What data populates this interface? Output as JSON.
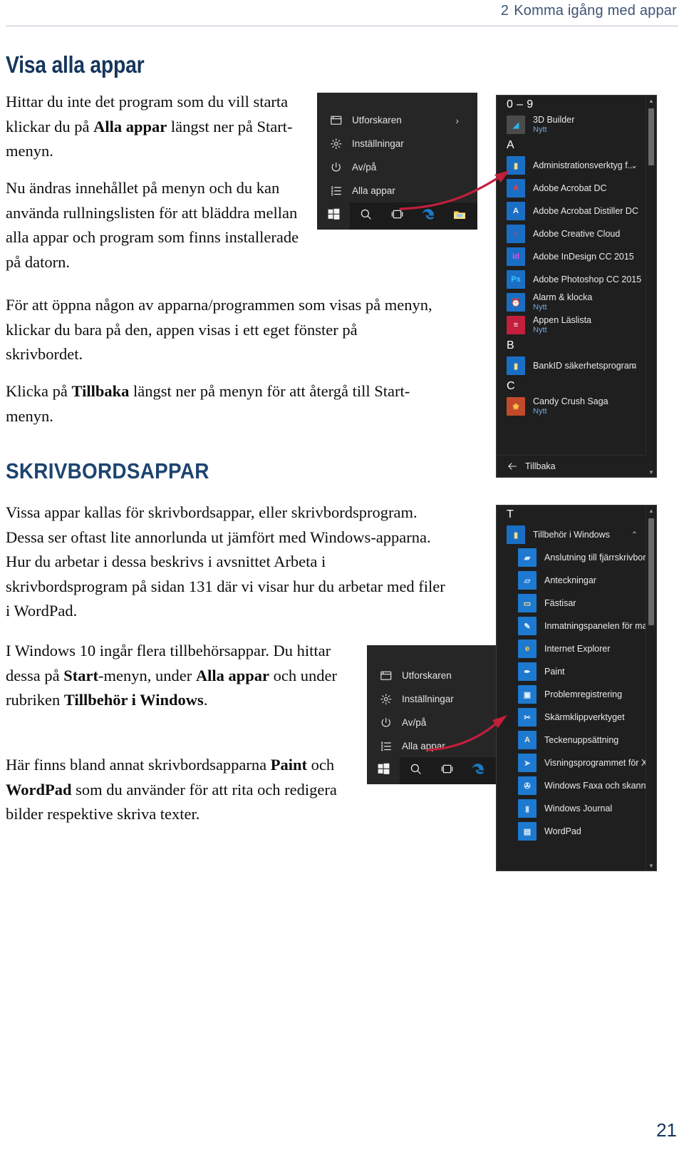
{
  "running_head": {
    "chapter_number": "2",
    "chapter_title": "Komma igång med appar"
  },
  "page_number": "21",
  "headings": {
    "h1": "Visa alla appar",
    "h2": "SKRIVBORDSAPPAR"
  },
  "paragraphs": {
    "p1_a": "Hittar du inte det program som du vill starta klickar du på ",
    "p1_b": "Alla appar",
    "p1_c": " längst ner på Start-menyn.",
    "p2": "Nu ändras innehållet på menyn och du kan använda rullningslisten för att bläddra mellan alla appar och program som finns installerade på datorn.",
    "p3": "För att öppna någon av apparna/programmen som visas på menyn, klickar du bara på den, appen visas i ett eget fönster på skrivbordet.",
    "p4_a": "Klicka på ",
    "p4_b": "Tillbaka",
    "p4_c": " längst ner på menyn för att återgå till Start-menyn.",
    "p5": "Vissa appar kallas för skrivbordsappar, eller skrivbordsprogram. Dessa ser oftast lite annorlunda ut jämfört med Windows-apparna. Hur du arbetar i dessa beskrivs i avsnittet Arbeta i skrivbordsprogram på sidan 131 där vi visar hur du arbetar med filer i WordPad.",
    "p6_a": "I Windows 10 ingår flera tillbehörsappar. Du hittar dessa på ",
    "p6_b": "Start",
    "p6_c": "-menyn, under ",
    "p6_d": "Alla appar",
    "p6_e": " och under rubriken ",
    "p6_f": "Tillbehör i Windows",
    "p6_g": ".",
    "p7_a": "Här finns bland annat skrivbordsapparna ",
    "p7_b": "Paint",
    "p7_c": " och ",
    "p7_d": "WordPad",
    "p7_e": " som du använder för att rita och redigera bilder respektive skriva texter."
  },
  "screenshots": {
    "start_menu_top": {
      "items": [
        {
          "label": "Utforskaren",
          "icon": "folder-explorer-icon",
          "chevron": "›"
        },
        {
          "label": "Inställningar",
          "icon": "gear-icon",
          "chevron": ""
        },
        {
          "label": "Av/på",
          "icon": "power-icon",
          "chevron": ""
        },
        {
          "label": "Alla appar",
          "icon": "list-icon",
          "chevron": ""
        }
      ],
      "taskbar": [
        {
          "name": "start-button",
          "icon": "windows-logo-icon"
        },
        {
          "name": "search-button",
          "icon": "search-icon"
        },
        {
          "name": "taskview-button",
          "icon": "task-view-icon"
        },
        {
          "name": "edge-button",
          "icon": "edge-icon"
        },
        {
          "name": "explorer-button",
          "icon": "folder-icon"
        }
      ]
    },
    "start_menu_bottom": {
      "items": [
        {
          "label": "Utforskaren",
          "icon": "folder-explorer-icon"
        },
        {
          "label": "Inställningar",
          "icon": "gear-icon"
        },
        {
          "label": "Av/på",
          "icon": "power-icon"
        },
        {
          "label": "Alla appar",
          "icon": "list-icon"
        }
      ],
      "taskbar": [
        {
          "name": "start-button",
          "icon": "windows-logo-icon"
        },
        {
          "name": "search-button",
          "icon": "search-icon"
        },
        {
          "name": "taskview-button",
          "icon": "task-view-icon"
        },
        {
          "name": "edge-button",
          "icon": "edge-icon"
        }
      ]
    },
    "all_apps_panel": {
      "groups": [
        {
          "letter": "0 – 9",
          "apps": [
            {
              "name": "3D Builder",
              "sub": "Nytt",
              "tile": "#4b4b4b",
              "glyph": "◢",
              "glyph_color": "#29b6e8",
              "caret": ""
            }
          ]
        },
        {
          "letter": "A",
          "apps": [
            {
              "name": "Administrationsverktyg f...",
              "sub": "",
              "tile": "#1a6fc4",
              "glyph": "▮",
              "glyph_color": "#f3dd8d",
              "caret": "⌄"
            },
            {
              "name": "Adobe Acrobat DC",
              "sub": "",
              "tile": "#1a6fc4",
              "glyph": "A",
              "glyph_color": "#ff3b30",
              "caret": ""
            },
            {
              "name": "Adobe Acrobat Distiller DC",
              "sub": "",
              "tile": "#1a6fc4",
              "glyph": "A",
              "glyph_color": "#f2f2f2",
              "caret": ""
            },
            {
              "name": "Adobe Creative Cloud",
              "sub": "",
              "tile": "#1a6fc4",
              "glyph": "○",
              "glyph_color": "#ff3b30",
              "caret": ""
            },
            {
              "name": "Adobe InDesign CC 2015",
              "sub": "",
              "tile": "#1a6fc4",
              "glyph": "Id",
              "glyph_color": "#ff3de0",
              "caret": ""
            },
            {
              "name": "Adobe Photoshop CC 2015",
              "sub": "",
              "tile": "#1a6fc4",
              "glyph": "Ps",
              "glyph_color": "#3ec8ff",
              "caret": ""
            },
            {
              "name": "Alarm & klocka",
              "sub": "Nytt",
              "tile": "#1a6fc4",
              "glyph": "⏰",
              "glyph_color": "#ffffff",
              "caret": ""
            },
            {
              "name": "Appen Läslista",
              "sub": "Nytt",
              "tile": "#c2203c",
              "glyph": "≡",
              "glyph_color": "#ffffff",
              "caret": ""
            }
          ]
        },
        {
          "letter": "B",
          "apps": [
            {
              "name": "BankID säkerhetsprogram",
              "sub": "",
              "tile": "#1a6fc4",
              "glyph": "▮",
              "glyph_color": "#f3dd8d",
              "caret": "⌄"
            }
          ]
        },
        {
          "letter": "C",
          "apps": [
            {
              "name": "Candy Crush Saga",
              "sub": "Nytt",
              "tile": "#c24a2b",
              "glyph": "❀",
              "glyph_color": "#ffd24a",
              "caret": ""
            }
          ]
        }
      ],
      "back_label": "Tillbaka",
      "back_icon": "arrow-left-icon"
    },
    "accessories_panel": {
      "letter": "T",
      "folder": {
        "name": "Tillbehör i Windows",
        "tile": "#1a6fc4",
        "glyph": "▮",
        "glyph_color": "#f3dd8d",
        "caret": "⌃"
      },
      "apps": [
        {
          "name": "Anslutning till fjärrskrivbord",
          "tile": "#1e7ad0",
          "glyph": "▰",
          "glyph_color": "#d8eaff"
        },
        {
          "name": "Anteckningar",
          "tile": "#1e7ad0",
          "glyph": "▱",
          "glyph_color": "#cfe6ff"
        },
        {
          "name": "Fästisar",
          "tile": "#1e7ad0",
          "glyph": "▭",
          "glyph_color": "#ffe488"
        },
        {
          "name": "Inmatningspanelen för mat...",
          "tile": "#1e7ad0",
          "glyph": "✎",
          "glyph_color": "#e7f2ff"
        },
        {
          "name": "Internet Explorer",
          "tile": "#1e7ad0",
          "glyph": "e",
          "glyph_color": "#ffd24a"
        },
        {
          "name": "Paint",
          "tile": "#1e7ad0",
          "glyph": "✒",
          "glyph_color": "#ffffff"
        },
        {
          "name": "Problemregistrering",
          "tile": "#1e7ad0",
          "glyph": "▣",
          "glyph_color": "#e3f0ff"
        },
        {
          "name": "Skärmklippverktyget",
          "tile": "#1e7ad0",
          "glyph": "✂",
          "glyph_color": "#dfeeff"
        },
        {
          "name": "Teckenuppsättning",
          "tile": "#1e7ad0",
          "glyph": "A",
          "glyph_color": "#f4e6c8"
        },
        {
          "name": "Visningsprogrammet för XPS",
          "tile": "#1e7ad0",
          "glyph": "➤",
          "glyph_color": "#cfe6ff"
        },
        {
          "name": "Windows Faxa och skanna",
          "tile": "#1e7ad0",
          "glyph": "✇",
          "glyph_color": "#dcecff"
        },
        {
          "name": "Windows Journal",
          "tile": "#1e7ad0",
          "glyph": "▮",
          "glyph_color": "#bcd9f5"
        },
        {
          "name": "WordPad",
          "tile": "#1e7ad0",
          "glyph": "▤",
          "glyph_color": "#e8f1fb"
        }
      ]
    }
  },
  "colors": {
    "heading": "#16365c",
    "runhead": "#3d5476",
    "arrow": "#c11f3c",
    "menu_bg": "#262626",
    "panel_bg": "#1f1f1f",
    "accent_blue": "#1a6fc4"
  }
}
